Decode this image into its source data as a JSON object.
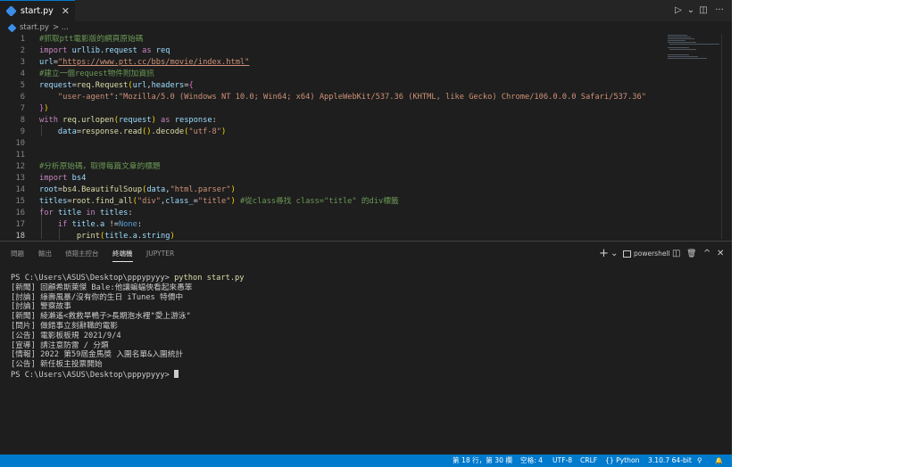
{
  "editor_tab": {
    "filename": "start.py",
    "close": "✕"
  },
  "toolbar": {
    "run": "▷",
    "run_menu": "⌄",
    "split": "◫",
    "more": "···"
  },
  "breadcrumb": {
    "file": "start.py",
    "rest": "> ..."
  },
  "code": {
    "l1": "#抓取ptt電影版的網頁原始碼",
    "import": "import",
    "urllib": "urllib.request",
    "as": "as",
    "req": "req",
    "url_var": "url",
    "url_str": "\"https://www.ptt.cc/bbs/movie/index.html\"",
    "l4": "#建立一個request物件附加資訊",
    "request_var": "request",
    "req_Request": "req.Request",
    "url_arg": "url",
    "headers": "headers",
    "ua_key": "\"user-agent\"",
    "ua_val": "\"Mozilla/5.0 (Windows NT 10.0; Win64; x64) AppleWebKit/537.36 (KHTML, like Gecko) Chrome/106.0.0.0 Safari/537.36\"",
    "with": "with",
    "urlopen": "req.urlopen",
    "request_arg": "request",
    "response": "response",
    "data_var": "data",
    "response_read": "response.read",
    "decode": "decode",
    "utf8": "\"utf-8\"",
    "l12": "#分析原始碼，取得每篇文章的標題",
    "bs4": "bs4",
    "root": "root",
    "bs": "bs4.BeautifulSoup",
    "data_arg": "data",
    "parser": "\"html.parser\"",
    "titles": "titles",
    "find_all": "root.find_all",
    "div": "\"div\"",
    "class_": "class_",
    "title_str": "\"title\"",
    "l15_comment": "#從class尋找 class=\"title\" 的div標籤",
    "for": "for",
    "title": "title",
    "in": "in",
    "titles_ref": "titles",
    "if": "if",
    "title_a": "title.a",
    "none": "None",
    "print": "print",
    "title_a_string": "title.a.string",
    "line_numbers": [
      "1",
      "2",
      "3",
      "4",
      "5",
      "6",
      "7",
      "8",
      "9",
      "10",
      "11",
      "12",
      "13",
      "14",
      "15",
      "16",
      "17",
      "18"
    ]
  },
  "panel": {
    "tabs": [
      "問題",
      "輸出",
      "偵錯主控台",
      "終端機",
      "JUPYTER"
    ],
    "add": "+",
    "add_menu": "⌄",
    "shell": "powershell",
    "split": "◫",
    "trash": "🗑",
    "maximize": "^",
    "close": "✕"
  },
  "terminal": {
    "prompt": "PS C:\\Users\\ASUS\\Desktop\\pppypyyy> ",
    "command": "python start.py",
    "lines": [
      "[新聞] 回顧希斯萊傑 Bale:他讓蝙蝠俠看起來愚笨",
      "[討論] 綠壽風暴/沒有你的生日 iTunes 特價中",
      "[討論] 警察故事",
      "[新聞] 綾瀨遙<救救旱鴨子>長期泡水裡\"愛上游泳\"",
      "[問片] 做錯事立刻辭職的電影",
      "[公告] 電影板板規 2021/9/4",
      "[宣導] 請注意防雷 / 分類",
      "[情報] 2022 第59屆金馬獎 入圍名單&入圍統計",
      "[公告] 新任板主投票開始"
    ],
    "final_prompt": "PS C:\\Users\\ASUS\\Desktop\\pppypyyy> "
  },
  "status": {
    "position": "第 18 行，第 30 欄",
    "spaces": "空格: 4",
    "encoding": "UTF-8",
    "eol": "CRLF",
    "language": "{} Python",
    "interpreter": "3.10.7 64-bit",
    "feedback": "⚲",
    "bell": "🔔"
  },
  "colors": {
    "accent": "#007acc",
    "background": "#1e1e1e"
  }
}
